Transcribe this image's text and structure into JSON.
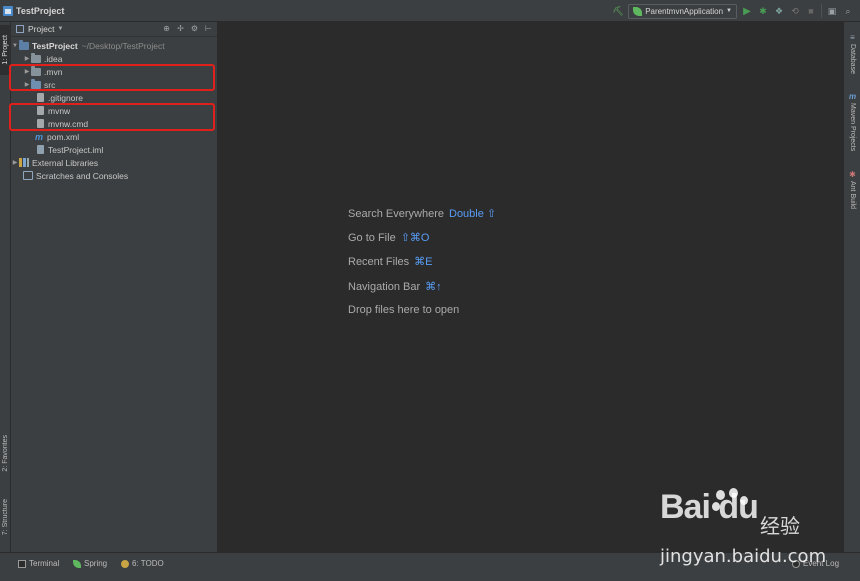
{
  "window": {
    "title": "TestProject"
  },
  "toolbar": {
    "run_config": "ParentmvnApplication"
  },
  "left_strip": {
    "project_tab": "1: Project",
    "favorites_tab": "2: Favorites",
    "structure_tab": "7: Structure"
  },
  "project_panel": {
    "view_label": "Project",
    "tree": {
      "root": {
        "name": "TestProject",
        "path": "~/Desktop/TestProject"
      },
      "idea": ".idea",
      "mvn": ".mvn",
      "src": "src",
      "gitignore": ".gitignore",
      "mvnw": "mvnw",
      "mvnw_cmd": "mvnw.cmd",
      "pom": "pom.xml",
      "iml": "TestProject.iml",
      "external_libraries": "External Libraries",
      "scratches": "Scratches and Consoles"
    }
  },
  "editor": {
    "hints": [
      {
        "label": "Search Everywhere",
        "shortcut": "Double ⇧"
      },
      {
        "label": "Go to File",
        "shortcut": "⇧⌘O"
      },
      {
        "label": "Recent Files",
        "shortcut": "⌘E"
      },
      {
        "label": "Navigation Bar",
        "shortcut": "⌘↑"
      },
      {
        "label": "Drop files here to open",
        "shortcut": ""
      }
    ]
  },
  "right_strip": {
    "database": "Database",
    "maven": "Maven Projects",
    "ant": "Ant Build"
  },
  "bottom_bar": {
    "terminal": "Terminal",
    "spring": "Spring",
    "todo": "6: TODO",
    "event_log": "Event Log"
  },
  "watermark": {
    "brand": "Bai du",
    "cn": "经验",
    "url": "jingyan.baidu.com"
  },
  "colors": {
    "highlight_box": "#e0201b",
    "shortcut": "#589df6",
    "background": "#2b2b2b",
    "panel": "#3c3f41"
  }
}
